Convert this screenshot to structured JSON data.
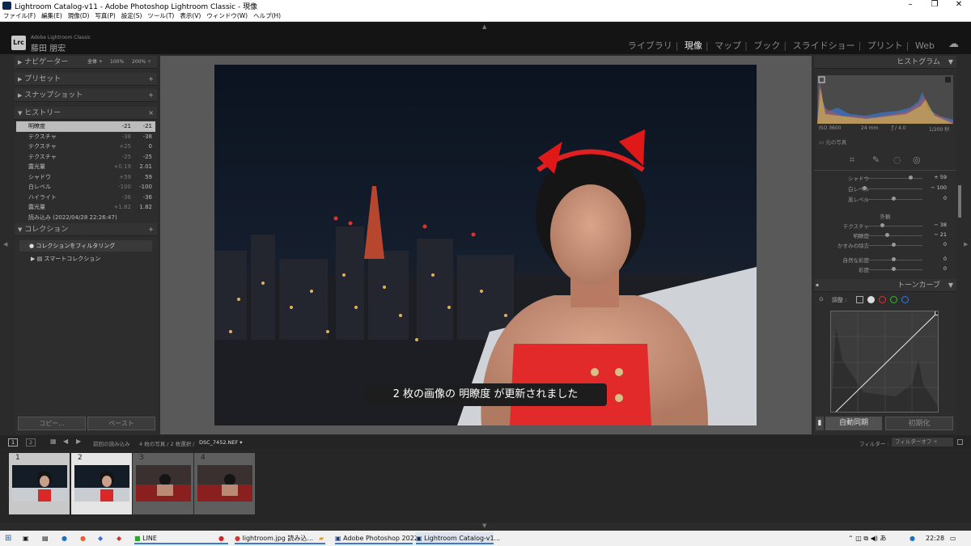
{
  "window": {
    "title": "Lightroom Catalog-v11 - Adobe Photoshop Lightroom Classic - 現像",
    "minimize": "–",
    "maximize": "❐",
    "close": "✕"
  },
  "menu": [
    "ファイル(F)",
    "編集(E)",
    "現像(D)",
    "写真(P)",
    "設定(S)",
    "ツール(T)",
    "表示(V)",
    "ウィンドウ(W)",
    "ヘルプ(H)"
  ],
  "header": {
    "logo": "Lrc",
    "brand": "Adobe Lightroom Classic",
    "user": "藤田 朋宏",
    "modules": [
      "ライブラリ",
      "現像",
      "マップ",
      "ブック",
      "スライドショー",
      "プリント",
      "Web"
    ],
    "active_module": "現像"
  },
  "left": {
    "navigator": {
      "label": "ナビゲーター",
      "fit": "全体 ÷",
      "z100": "100%",
      "z200": "200% ÷"
    },
    "presets": {
      "label": "プリセット",
      "action": "+"
    },
    "snapshots": {
      "label": "スナップショット",
      "action": "+"
    },
    "history": {
      "label": "ヒストリー",
      "action": "×",
      "items": [
        {
          "name": "明瞭度",
          "a": "-21",
          "b": "-21"
        },
        {
          "name": "テクスチャ",
          "a": "-38",
          "b": "-38"
        },
        {
          "name": "テクスチャ",
          "a": "+25",
          "b": "0"
        },
        {
          "name": "テクスチャ",
          "a": "-25",
          "b": "-25"
        },
        {
          "name": "露光量",
          "a": "+0.19",
          "b": "2.01"
        },
        {
          "name": "シャドウ",
          "a": "+59",
          "b": "59"
        },
        {
          "name": "白レベル",
          "a": "-100",
          "b": "-100"
        },
        {
          "name": "ハイライト",
          "a": "-36",
          "b": "-36"
        },
        {
          "name": "露光量",
          "a": "+1.82",
          "b": "1.82"
        },
        {
          "name": "読み込み (2022/04/28 22:26:47)",
          "a": "",
          "b": ""
        }
      ]
    },
    "collections": {
      "label": "コレクション",
      "action": "+",
      "filter": "コレクションをフィルタリング",
      "smart": "スマートコレクション"
    },
    "copy": "コピー...",
    "paste": "ペースト"
  },
  "center": {
    "toast": "2 枚の画像の 明瞭度 が更新されました"
  },
  "right": {
    "histogram": {
      "label": "ヒストグラム",
      "iso": "ISO 3600",
      "focal": "24 mm",
      "aperture": "ƒ / 4.0",
      "shutter": "1/200 秒",
      "original": "元の写真"
    },
    "sliders_basic": [
      {
        "label": "シャドウ",
        "value": "+ 59",
        "pos": 0.8
      },
      {
        "label": "白レベル",
        "value": "− 100",
        "pos": 0.0
      },
      {
        "label": "黒レベル",
        "value": "0",
        "pos": 0.5
      }
    ],
    "presence_label": "外観",
    "sliders_presence": [
      {
        "label": "テクスチャ",
        "value": "− 38",
        "pos": 0.31
      },
      {
        "label": "明瞭度",
        "value": "− 21",
        "pos": 0.4
      },
      {
        "label": "かすみの除去",
        "value": "0",
        "pos": 0.5
      },
      {
        "label": "自然な彩度",
        "value": "0",
        "pos": 0.5
      },
      {
        "label": "彩度",
        "value": "0",
        "pos": 0.5
      }
    ],
    "tonecurve": {
      "label": "トーンカーブ",
      "adjust": "調整 :"
    },
    "autosync": "自動同期",
    "reset": "初期化"
  },
  "filmbar": {
    "v1": "1",
    "v2": "2",
    "path": "前回の読み込み",
    "count": "4 枚の写真 / 2 枚選択 /",
    "file": "DSC_7452.NEF ▾",
    "filter_label": "フィルター :",
    "filter_value": "フィルターオフ ÷"
  },
  "thumbs": [
    {
      "n": "1"
    },
    {
      "n": "2"
    },
    {
      "n": "3"
    },
    {
      "n": "4"
    }
  ],
  "taskbar": {
    "items": [
      "LINE",
      "lightroom.jpg 読み込...",
      "Adobe Photoshop 2022",
      "Lightroom Catalog-v1..."
    ],
    "time": "22:28"
  }
}
